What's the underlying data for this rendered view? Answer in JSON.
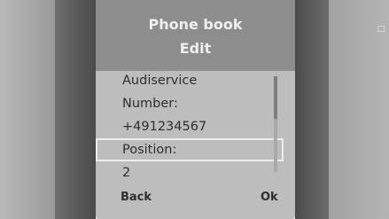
{
  "header": {
    "title": "Phone book",
    "subtitle": "Edit"
  },
  "fields": [
    {
      "text": "Audiservice",
      "selected": false
    },
    {
      "text": "Number:",
      "selected": false
    },
    {
      "text": "+491234567",
      "selected": false
    },
    {
      "text": "Position:",
      "selected": true
    },
    {
      "text": "2",
      "selected": false
    }
  ],
  "softkeys": {
    "left": "Back",
    "right": "Ok"
  },
  "side_mark": "□"
}
